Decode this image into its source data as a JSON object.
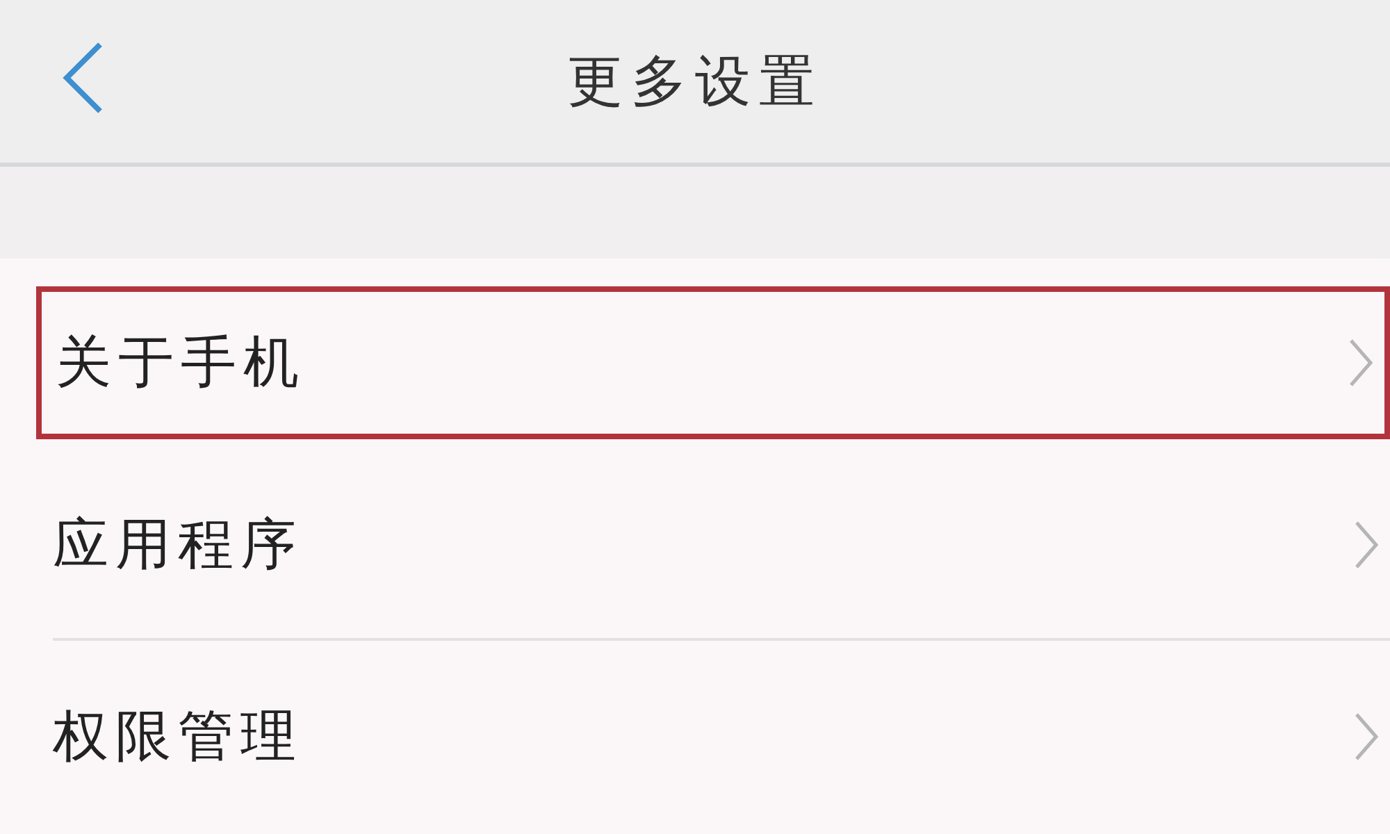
{
  "header": {
    "title": "更多设置"
  },
  "items": [
    {
      "label": "关于手机",
      "highlighted": true
    },
    {
      "label": "应用程序",
      "highlighted": false
    },
    {
      "label": "权限管理",
      "highlighted": false
    }
  ]
}
